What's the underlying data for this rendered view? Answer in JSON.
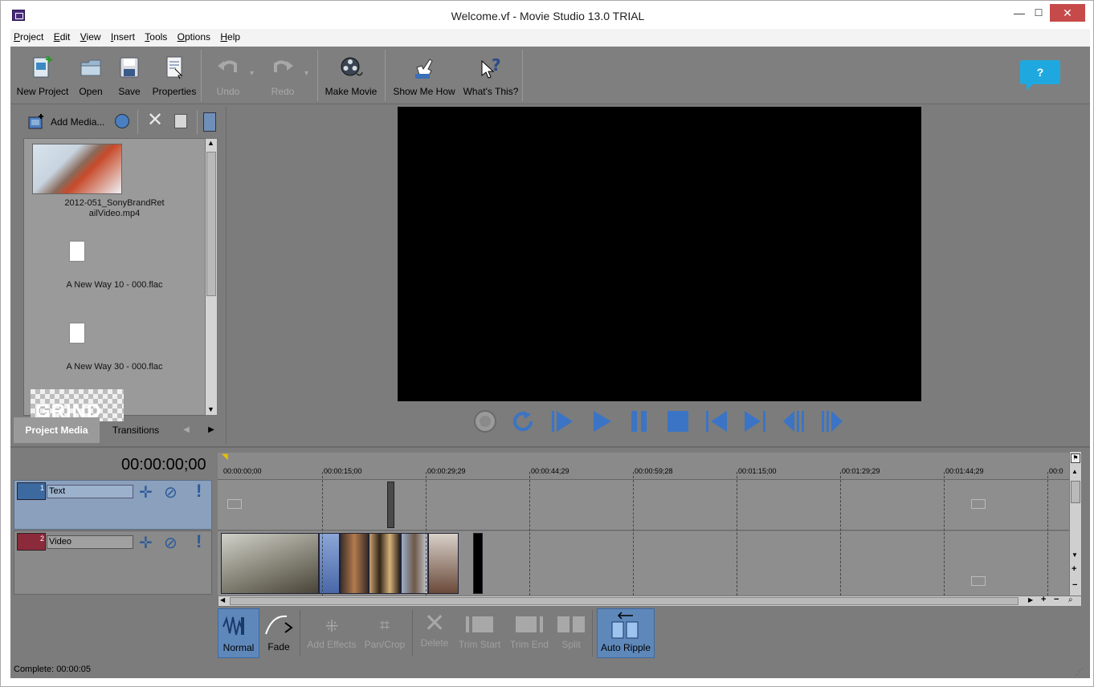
{
  "window": {
    "title": "Welcome.vf - Movie Studio 13.0 TRIAL",
    "minimize": "—",
    "maximize": "☐",
    "close": "✕"
  },
  "menu": [
    "Project",
    "Edit",
    "View",
    "Insert",
    "Tools",
    "Options",
    "Help"
  ],
  "toolbar": {
    "new_project": "New Project",
    "open": "Open",
    "save": "Save",
    "properties": "Properties",
    "undo": "Undo",
    "redo": "Redo",
    "make_movie": "Make Movie",
    "show_me_how": "Show Me How",
    "whats_this": "What's This?",
    "help": "?"
  },
  "media": {
    "add_media": "Add Media...",
    "items": [
      {
        "name": "2012-051_SonyBrandRet\nailVideo.mp4"
      },
      {
        "name": "A New Way 10 - 000.flac"
      },
      {
        "name": "A New Way 30 - 000.flac"
      },
      {
        "name": "GRIND"
      }
    ],
    "tabs": {
      "project_media": "Project Media",
      "transitions": "Transitions"
    }
  },
  "timeline": {
    "timecode": "00:00:00;00",
    "ruler": [
      "00:00:00;00",
      "00:00:15;00",
      "00:00:29;29",
      "00:00:44;29",
      "00:00:59;28",
      "00:01:15;00",
      "00:01:29;29",
      "00:01:44;29",
      "00:0"
    ],
    "tracks": [
      {
        "number": "1",
        "name": "Text"
      },
      {
        "number": "2",
        "name": "Video"
      }
    ]
  },
  "editbar": {
    "normal": "Normal",
    "fade": "Fade",
    "add_effects": "Add Effects",
    "pan_crop": "Pan/Crop",
    "delete": "Delete",
    "trim_start": "Trim Start",
    "trim_end": "Trim End",
    "split": "Split",
    "auto_ripple": "Auto Ripple"
  },
  "status": "Complete: 00:00:05"
}
